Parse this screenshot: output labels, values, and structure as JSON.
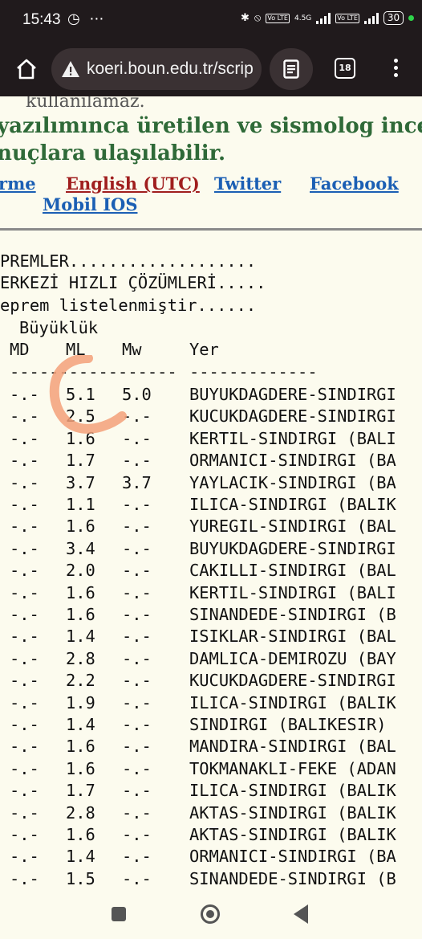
{
  "status_bar": {
    "time": "15:43",
    "left_icons": "◷ ⋯",
    "lte1": "Vo LTE",
    "net": "4.5G",
    "lte2": "Vo LTE",
    "battery": "30"
  },
  "browser": {
    "url": "koeri.boun.edu.tr/scrip",
    "tab_count": "18"
  },
  "page": {
    "faded_line": "kullanılamaz.",
    "headline1": "yazılımınca üretilen ve sismolog ince",
    "headline2": "nuçlara ulaşılabilir.",
    "links": [
      "rme",
      "English (UTC)",
      "Twitter",
      "Facebook",
      "Mobil IOS"
    ],
    "pre_line1": "PREMLER...................",
    "pre_line2": "ERKEZİ HIZLI ÇÖZÜMLERİ.....",
    "pre_line3": "eprem listelenmiştir......",
    "header_buyukluk": "Büyüklük",
    "headers": [
      "MD",
      "ML",
      "Mw",
      "Yer"
    ],
    "dashes_mag": "-----------------",
    "dashes_yer": "-------------"
  },
  "rows": [
    {
      "md": "-.-",
      "ml": "5.1",
      "mw": "5.0",
      "yer": "BUYUKDAGDERE-SINDIRGI"
    },
    {
      "md": "-.-",
      "ml": "2.5",
      "mw": "-.-",
      "yer": "KUCUKDAGDERE-SINDIRGI"
    },
    {
      "md": "-.-",
      "ml": "1.6",
      "mw": "-.-",
      "yer": "KERTIL-SINDIRGI (BALI"
    },
    {
      "md": "-.-",
      "ml": "1.7",
      "mw": "-.-",
      "yer": "ORMANICI-SINDIRGI (BA"
    },
    {
      "md": "-.-",
      "ml": "3.7",
      "mw": "3.7",
      "yer": "YAYLACIK-SINDIRGI (BA"
    },
    {
      "md": "-.-",
      "ml": "1.1",
      "mw": "-.-",
      "yer": "ILICA-SINDIRGI (BALIK"
    },
    {
      "md": "-.-",
      "ml": "1.6",
      "mw": "-.-",
      "yer": "YUREGIL-SINDIRGI (BAL"
    },
    {
      "md": "-.-",
      "ml": "3.4",
      "mw": "-.-",
      "yer": "BUYUKDAGDERE-SINDIRGI"
    },
    {
      "md": "-.-",
      "ml": "2.0",
      "mw": "-.-",
      "yer": "CAKILLI-SINDIRGI (BAL"
    },
    {
      "md": "-.-",
      "ml": "1.6",
      "mw": "-.-",
      "yer": "KERTIL-SINDIRGI (BALI"
    },
    {
      "md": "-.-",
      "ml": "1.6",
      "mw": "-.-",
      "yer": "SINANDEDE-SINDIRGI (B"
    },
    {
      "md": "-.-",
      "ml": "1.4",
      "mw": "-.-",
      "yer": "ISIKLAR-SINDIRGI (BAL"
    },
    {
      "md": "-.-",
      "ml": "2.8",
      "mw": "-.-",
      "yer": "DAMLICA-DEMIROZU (BAY"
    },
    {
      "md": "-.-",
      "ml": "2.2",
      "mw": "-.-",
      "yer": "KUCUKDAGDERE-SINDIRGI"
    },
    {
      "md": "-.-",
      "ml": "1.9",
      "mw": "-.-",
      "yer": "ILICA-SINDIRGI (BALIK"
    },
    {
      "md": "-.-",
      "ml": "1.4",
      "mw": "-.-",
      "yer": "SINDIRGI (BALIKESIR)"
    },
    {
      "md": "-.-",
      "ml": "1.6",
      "mw": "-.-",
      "yer": "MANDIRA-SINDIRGI (BAL"
    },
    {
      "md": "-.-",
      "ml": "1.6",
      "mw": "-.-",
      "yer": "TOKMANAKLI-FEKE (ADAN"
    },
    {
      "md": "-.-",
      "ml": "1.7",
      "mw": "-.-",
      "yer": "ILICA-SINDIRGI (BALIK"
    },
    {
      "md": "-.-",
      "ml": "2.8",
      "mw": "-.-",
      "yer": "AKTAS-SINDIRGI (BALIK"
    },
    {
      "md": "-.-",
      "ml": "1.6",
      "mw": "-.-",
      "yer": "AKTAS-SINDIRGI (BALIK"
    },
    {
      "md": "-.-",
      "ml": "1.4",
      "mw": "-.-",
      "yer": "ORMANICI-SINDIRGI (BA"
    },
    {
      "md": "-.-",
      "ml": "1.5",
      "mw": "-.-",
      "yer": "SINANDEDE-SINDIRGI (B"
    }
  ],
  "colors": {
    "annotation": "#f3a079",
    "headline": "#2f6a38",
    "link": "#1b5fb4",
    "link_active": "#a01e1e"
  }
}
